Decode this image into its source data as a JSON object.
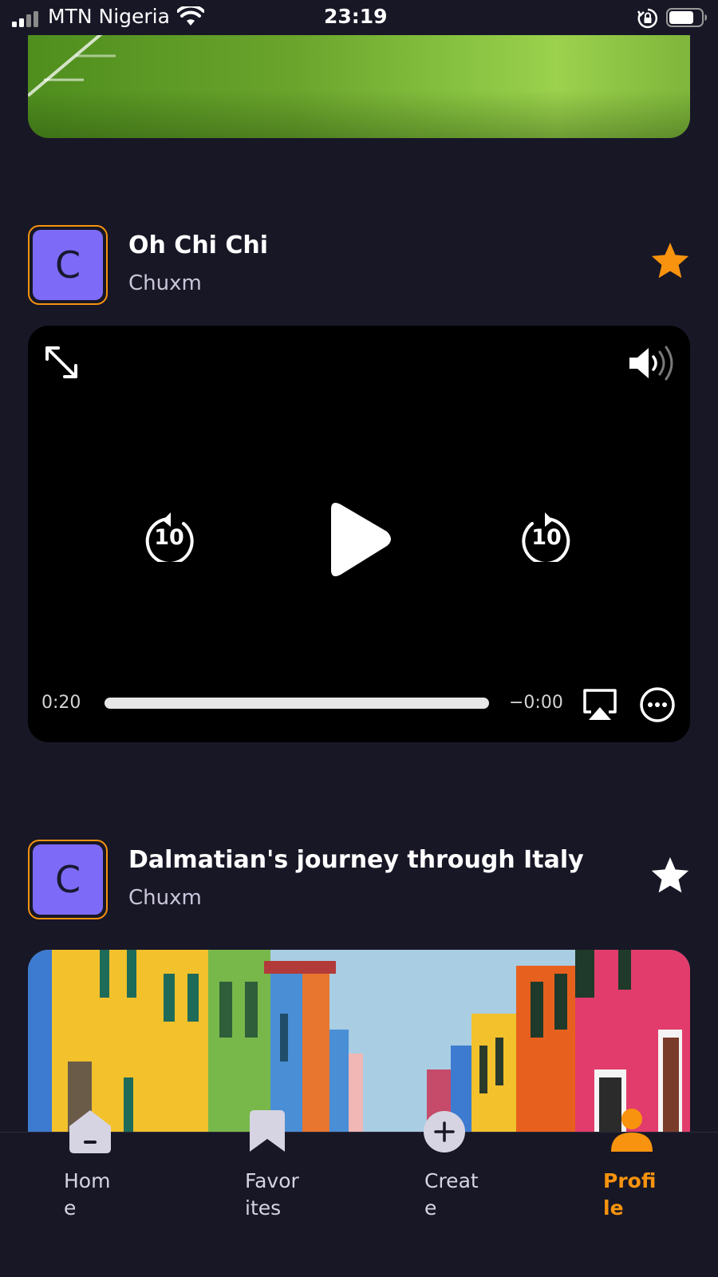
{
  "status_bar": {
    "carrier": "MTN Nigeria",
    "time": "23:19"
  },
  "posts": [
    {
      "title": "Oh Chi Chi",
      "author": "Chuxm",
      "avatar_letter": "C",
      "favorited": true,
      "media": "video",
      "video": {
        "elapsed": "0:20",
        "remaining": "−0:00",
        "skip_back_seconds": "10",
        "skip_forward_seconds": "10",
        "progress": 1.0
      }
    },
    {
      "title": "Dalmatian's journey through Italy",
      "author": "Chuxm",
      "avatar_letter": "C",
      "favorited": false,
      "media": "image"
    }
  ],
  "tabs": [
    {
      "label": "Home",
      "icon": "home-icon",
      "active": false
    },
    {
      "label": "Favorites",
      "icon": "bookmark-icon",
      "active": false
    },
    {
      "label": "Create",
      "icon": "plus-icon",
      "active": false
    },
    {
      "label": "Profile",
      "icon": "profile-icon",
      "active": true
    }
  ],
  "colors": {
    "background": "#181726",
    "accent": "#f7930e",
    "avatar": "#7d6bf7",
    "star_inactive": "#ffffff"
  }
}
